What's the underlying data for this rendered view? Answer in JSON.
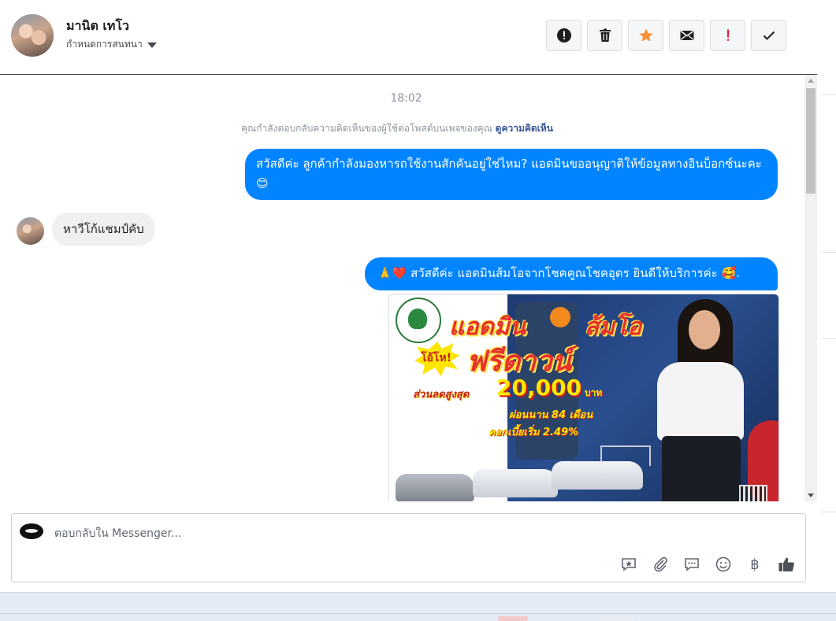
{
  "header": {
    "contact_name": "มานิต เทโว",
    "assign_label": "กำหนดการสนทนา"
  },
  "actions": [
    {
      "name": "spam-button",
      "icon": "alert-circle-icon"
    },
    {
      "name": "delete-button",
      "icon": "trash-icon"
    },
    {
      "name": "star-button",
      "icon": "star-icon",
      "color": "#f7923a"
    },
    {
      "name": "mark-unread-button",
      "icon": "envelope-icon"
    },
    {
      "name": "important-button",
      "icon": "exclamation-icon",
      "color": "#e41e3f"
    },
    {
      "name": "done-button",
      "icon": "checkmark-icon"
    }
  ],
  "conversation": {
    "timestamp": "18:02",
    "context_text": "คุณกำลังตอบกลับความคิดเห็นของผู้ใช้ต่อโพสต์บนเพจของคุณ",
    "context_link": "ดูความคิดเห็น",
    "messages": [
      {
        "from": "page",
        "text": "สวัสดีค่ะ ลูกค้ากำลังมองหารถใช้งานสักคันอยู่ใช่ไหม? แอดมินขออนุญาติให้ข้อมูลทางอินบ็อกซ์นะคะ 😊"
      },
      {
        "from": "user",
        "text": "หาวีโก้แชมป์คับ"
      },
      {
        "from": "page",
        "text": "🙏❤️ สวัสดีค่ะ แอดมินส้มโอจากโชคคูณโชคอุดร ยินดีให้บริการค่ะ 🥰."
      }
    ],
    "promo": {
      "title_left": "แอดมิน",
      "title_right": "ส้มโอ",
      "burst": "โอ้โห!",
      "headline": "ฟรีดาวน์",
      "discount_label": "ส่วนลดสูงสุด",
      "discount_amount": "20,000",
      "currency": "บาท",
      "installment": "ผ่อนนาน 84 เดือน",
      "interest": "ดอกเบี้ยเริ่ม 2.49%"
    }
  },
  "composer": {
    "placeholder": "ตอบกลับใน Messenger...",
    "currency_symbol": "฿"
  },
  "colors": {
    "accent": "#0084ff",
    "star": "#f7923a",
    "alert": "#e41e3f"
  }
}
